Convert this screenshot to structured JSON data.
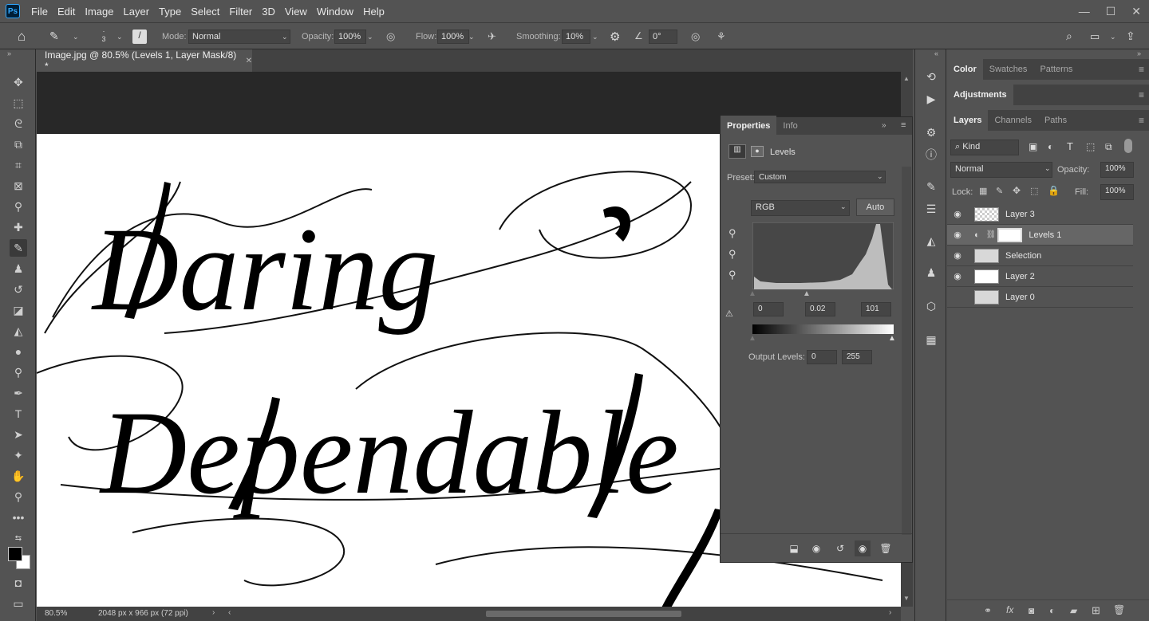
{
  "menubar": {
    "app_icon": "Ps",
    "items": [
      "File",
      "Edit",
      "Image",
      "Layer",
      "Type",
      "Select",
      "Filter",
      "3D",
      "View",
      "Window",
      "Help"
    ]
  },
  "options": {
    "brush_size": "3",
    "mode_label": "Mode:",
    "mode_value": "Normal",
    "opacity_label": "Opacity:",
    "opacity_value": "100%",
    "flow_label": "Flow:",
    "flow_value": "100%",
    "smoothing_label": "Smoothing:",
    "smoothing_value": "10%",
    "angle_value": "0°"
  },
  "document": {
    "tab_title": "Image.jpg @ 80.5% (Levels 1, Layer Mask/8) *",
    "zoom": "80.5%",
    "doc_info": "2048 px x 966 px (72 ppi)",
    "words": [
      "Daring",
      "Dependable"
    ]
  },
  "properties": {
    "tabs": [
      "Properties",
      "Info"
    ],
    "title": "Levels",
    "preset_label": "Preset:",
    "preset_value": "Custom",
    "channel_value": "RGB",
    "auto_label": "Auto",
    "input_black": "0",
    "input_gamma": "0.02",
    "input_white": "101",
    "output_label": "Output Levels:",
    "output_black": "0",
    "output_white": "255"
  },
  "panels": {
    "top_tabs": [
      "Color",
      "Swatches",
      "Patterns"
    ],
    "adjustments_tab": "Adjustments",
    "layers_tabs": [
      "Layers",
      "Channels",
      "Paths"
    ],
    "kind_label": "Kind",
    "blend_mode": "Normal",
    "opacity_label": "Opacity:",
    "opacity_value": "100%",
    "lock_label": "Lock:",
    "fill_label": "Fill:",
    "fill_value": "100%"
  },
  "layers": [
    {
      "name": "Layer 3",
      "visible": true,
      "thumb": "transparent"
    },
    {
      "name": "Levels 1",
      "visible": true,
      "thumb": "mask",
      "selected": true
    },
    {
      "name": "Selection",
      "visible": true,
      "thumb": "texture"
    },
    {
      "name": "Layer 2",
      "visible": true,
      "thumb": "white"
    },
    {
      "name": "Layer 0",
      "visible": false,
      "thumb": "texture"
    }
  ]
}
